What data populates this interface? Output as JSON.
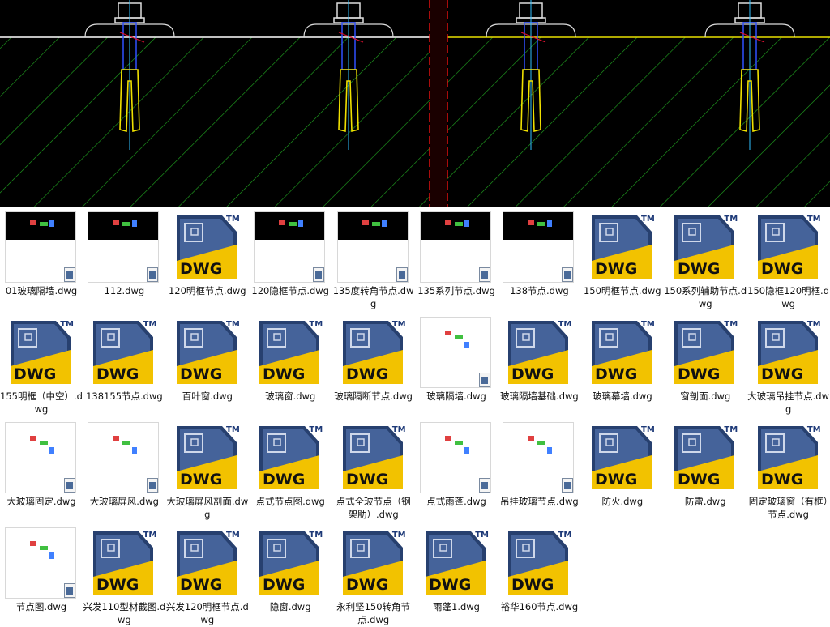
{
  "preview": {
    "description_hidden": ""
  },
  "icon": {
    "name": "dwg-file-icon",
    "text": "DWG",
    "tm": "TM",
    "colors": {
      "navy": "#27406f",
      "yellow": "#f2c200"
    }
  },
  "files": [
    {
      "label": "01玻璃隔墙.dwg",
      "kind": "thumb-dark"
    },
    {
      "label": "112.dwg",
      "kind": "thumb-dark"
    },
    {
      "label": "120明框节点.dwg",
      "kind": "dwg"
    },
    {
      "label": "120隐框节点.dwg",
      "kind": "thumb-dark"
    },
    {
      "label": "135度转角节点.dwg",
      "kind": "thumb-dark"
    },
    {
      "label": "135系列节点.dwg",
      "kind": "thumb-dark"
    },
    {
      "label": "138节点.dwg",
      "kind": "thumb-dark"
    },
    {
      "label": "150明框节点.dwg",
      "kind": "dwg"
    },
    {
      "label": "150系列辅助节点.dwg",
      "kind": "dwg"
    },
    {
      "label": "150隐框120明框.dwg",
      "kind": "dwg"
    },
    {
      "label": "155明框（中空）.dwg",
      "kind": "dwg"
    },
    {
      "label": "138155节点.dwg",
      "kind": "dwg"
    },
    {
      "label": "百叶窗.dwg",
      "kind": "dwg"
    },
    {
      "label": "玻璃窗.dwg",
      "kind": "dwg"
    },
    {
      "label": "玻璃隔断节点.dwg",
      "kind": "dwg"
    },
    {
      "label": "玻璃隔墙.dwg",
      "kind": "thumb-light"
    },
    {
      "label": "玻璃隔墙基础.dwg",
      "kind": "dwg"
    },
    {
      "label": "玻璃幕墙.dwg",
      "kind": "dwg"
    },
    {
      "label": "窗剖面.dwg",
      "kind": "dwg"
    },
    {
      "label": "大玻璃吊挂节点.dwg",
      "kind": "dwg"
    },
    {
      "label": "大玻璃固定.dwg",
      "kind": "thumb-light"
    },
    {
      "label": "大玻璃屏风.dwg",
      "kind": "thumb-light"
    },
    {
      "label": "大玻璃屏风剖面.dwg",
      "kind": "dwg"
    },
    {
      "label": "点式节点图.dwg",
      "kind": "dwg"
    },
    {
      "label": "点式全玻节点（钢架肋）.dwg",
      "kind": "dwg"
    },
    {
      "label": "点式雨蓬.dwg",
      "kind": "thumb-light"
    },
    {
      "label": "吊挂玻璃节点.dwg",
      "kind": "thumb-light"
    },
    {
      "label": "防火.dwg",
      "kind": "dwg"
    },
    {
      "label": "防雷.dwg",
      "kind": "dwg"
    },
    {
      "label": "固定玻璃窗（有框）节点.dwg",
      "kind": "dwg"
    },
    {
      "label": "节点图.dwg",
      "kind": "thumb-light"
    },
    {
      "label": "兴发110型材截图.dwg",
      "kind": "dwg"
    },
    {
      "label": "兴发120明框节点.dwg",
      "kind": "dwg"
    },
    {
      "label": "隐窗.dwg",
      "kind": "dwg"
    },
    {
      "label": "永利坚150转角节点.dwg",
      "kind": "dwg"
    },
    {
      "label": "雨蓬1.dwg",
      "kind": "dwg"
    },
    {
      "label": "裕华160节点.dwg",
      "kind": "dwg"
    }
  ]
}
